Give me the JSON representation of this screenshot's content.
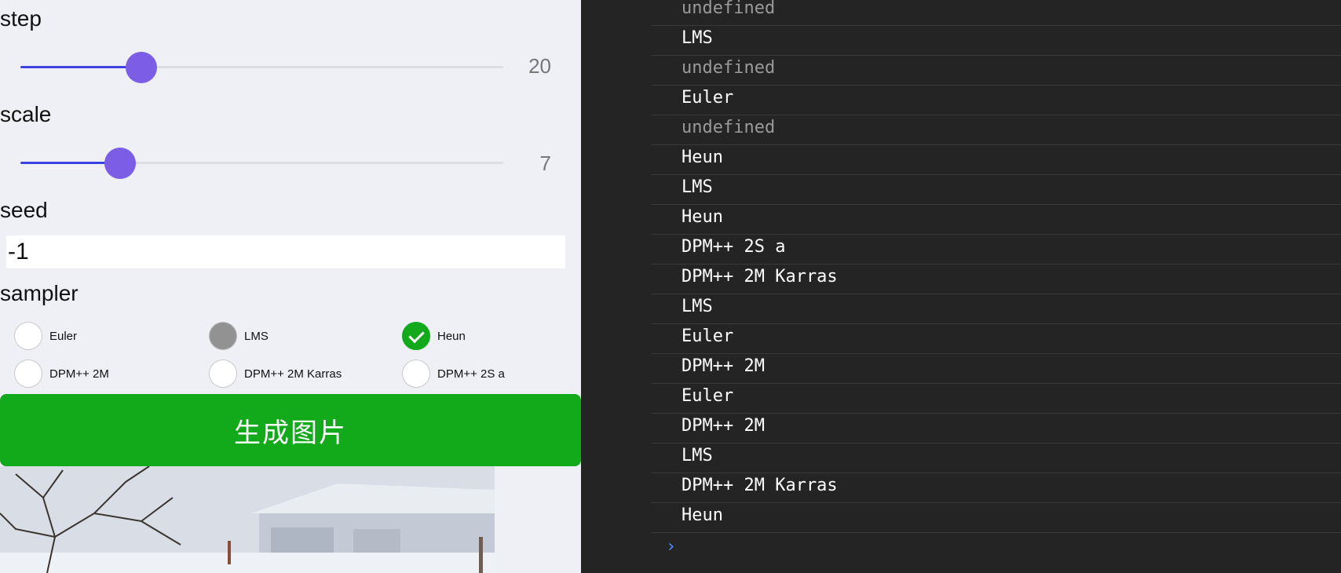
{
  "form": {
    "step": {
      "label": "step",
      "value": "20",
      "fraction": 0.25
    },
    "scale": {
      "label": "scale",
      "value": "7",
      "fraction": 0.206
    },
    "seed": {
      "label": "seed",
      "value": "-1"
    },
    "sampler": {
      "label": "sampler",
      "options": [
        {
          "label": "Euler",
          "state": "unchecked"
        },
        {
          "label": "LMS",
          "state": "pressed"
        },
        {
          "label": "Heun",
          "state": "checked"
        },
        {
          "label": "DPM++ 2M",
          "state": "unchecked"
        },
        {
          "label": "DPM++ 2M Karras",
          "state": "unchecked"
        },
        {
          "label": "DPM++ 2S a",
          "state": "unchecked"
        }
      ]
    },
    "generate_label": "生成图片"
  },
  "console": {
    "lines": [
      {
        "text": "undefined",
        "dim": true
      },
      {
        "text": "LMS",
        "dim": false
      },
      {
        "text": "undefined",
        "dim": true
      },
      {
        "text": "Euler",
        "dim": false
      },
      {
        "text": "undefined",
        "dim": true
      },
      {
        "text": "Heun",
        "dim": false
      },
      {
        "text": "LMS",
        "dim": false
      },
      {
        "text": "Heun",
        "dim": false
      },
      {
        "text": "DPM++ 2S a",
        "dim": false
      },
      {
        "text": "DPM++ 2M Karras",
        "dim": false
      },
      {
        "text": "LMS",
        "dim": false
      },
      {
        "text": "Euler",
        "dim": false
      },
      {
        "text": "DPM++ 2M",
        "dim": false
      },
      {
        "text": "Euler",
        "dim": false
      },
      {
        "text": "DPM++ 2M",
        "dim": false
      },
      {
        "text": "LMS",
        "dim": false
      },
      {
        "text": "DPM++ 2M Karras",
        "dim": false
      },
      {
        "text": "Heun",
        "dim": false
      }
    ],
    "prompt_icon": "chevron-right-icon"
  },
  "colors": {
    "accent_green": "#12a91a",
    "slider_fill": "#3d43e0",
    "slider_thumb": "#7b5de6",
    "console_bg": "#242424",
    "prompt_blue": "#4d8dff"
  }
}
